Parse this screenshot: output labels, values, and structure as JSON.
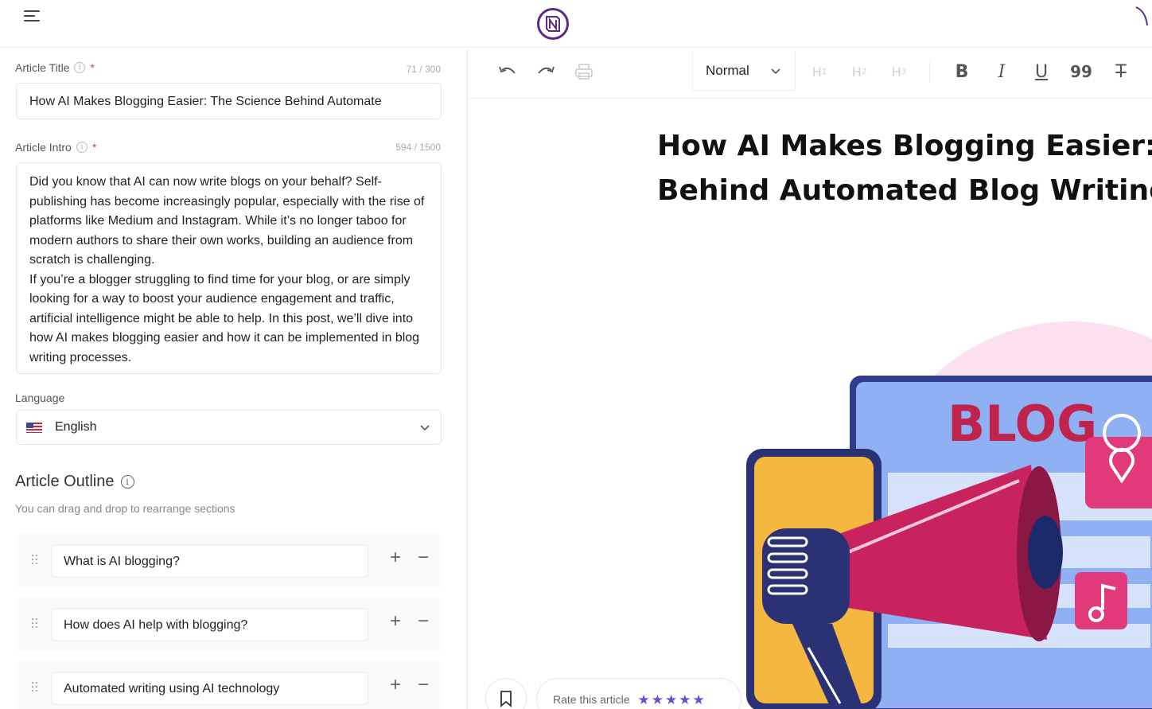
{
  "app": {
    "logo_glyph": "N",
    "brand_color": "#5a2a8a"
  },
  "form": {
    "title_label": "Article Title",
    "title_counter": "71 / 300",
    "title_value": "How AI Makes Blogging Easier: The Science Behind Automate",
    "intro_label": "Article Intro",
    "intro_counter": "594 / 1500",
    "intro_paragraphs": [
      "Did you know that AI can now write blogs on your behalf? Self-publishing has become increasingly popular, especially with the rise of platforms like Medium and Instagram. While it’s no longer taboo for modern authors to share their own works, building an audience from scratch is challenging.",
      "If you’re a blogger struggling to find time for your blog, or are simply looking for a way to boost your audience engagement and traffic, artificial intelligence might be able to help. In this post, we’ll dive into how AI makes blogging easier and how it can be implemented in blog writing processes."
    ],
    "required_mark": "*",
    "info_glyph": "i",
    "language_label": "Language",
    "language_value": "English"
  },
  "outline": {
    "title": "Article Outline",
    "hint": "You can drag and drop to rearrange sections",
    "items": [
      "What is AI blogging?",
      "How does AI help with blogging?",
      "Automated writing using AI technology"
    ],
    "add_glyph": "+",
    "remove_glyph": "−"
  },
  "editor": {
    "style_value": "Normal",
    "headings": [
      {
        "letter": "H",
        "num": "1"
      },
      {
        "letter": "H",
        "num": "2"
      },
      {
        "letter": "H",
        "num": "3"
      }
    ],
    "format_buttons": {
      "bold": "B",
      "italic": "I",
      "underline": "U",
      "quote": "99",
      "clear": "T"
    },
    "document_title_lines": [
      "How AI Makes Blogging Easier: The Science",
      "Behind Automated Blog Writing"
    ],
    "illustration_text": "BLOG",
    "rate_label": "Rate this article",
    "rating": 5,
    "star_color": "#5b55d6"
  }
}
